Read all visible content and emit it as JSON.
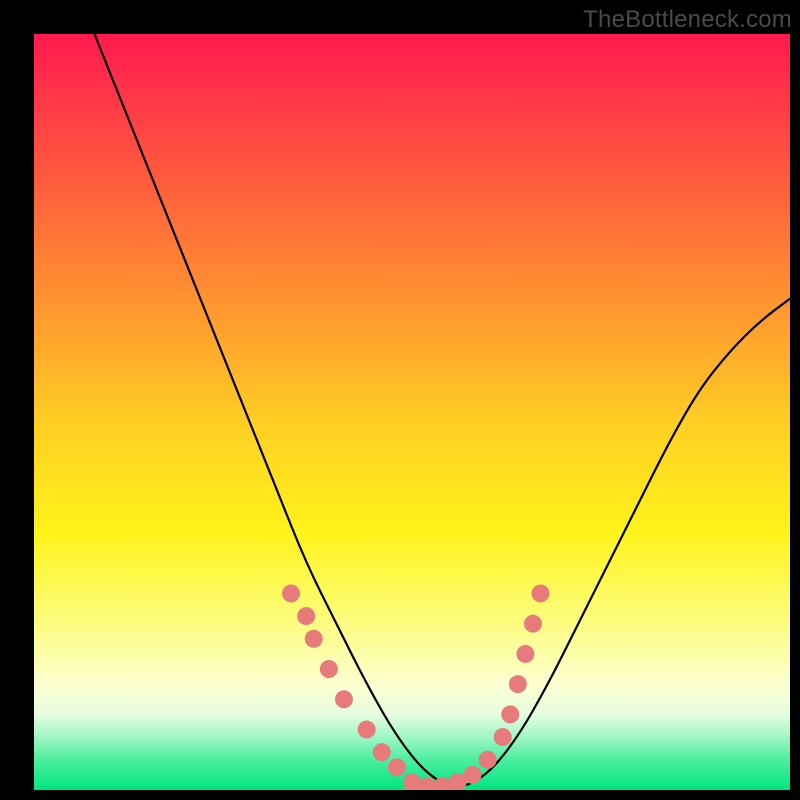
{
  "watermark": "TheBottleneck.com",
  "chart_data": {
    "type": "line",
    "title": "",
    "xlabel": "",
    "ylabel": "",
    "xlim": [
      0,
      100
    ],
    "ylim": [
      0,
      100
    ],
    "series": [
      {
        "name": "bottleneck-curve",
        "x": [
          8,
          12,
          16,
          20,
          24,
          28,
          32,
          36,
          40,
          44,
          48,
          52,
          56,
          60,
          64,
          68,
          72,
          76,
          80,
          84,
          88,
          92,
          96,
          100
        ],
        "y": [
          100,
          90,
          80,
          70,
          60,
          50,
          40,
          30,
          22,
          14,
          7,
          2,
          0,
          2,
          7,
          14,
          22,
          30,
          38,
          46,
          53,
          58,
          62,
          65
        ]
      }
    ],
    "scatter_points": {
      "name": "highlighted-points",
      "points": [
        {
          "x": 34,
          "y": 26
        },
        {
          "x": 36,
          "y": 23
        },
        {
          "x": 37,
          "y": 20
        },
        {
          "x": 39,
          "y": 16
        },
        {
          "x": 41,
          "y": 12
        },
        {
          "x": 44,
          "y": 8
        },
        {
          "x": 46,
          "y": 5
        },
        {
          "x": 48,
          "y": 3
        },
        {
          "x": 50,
          "y": 1
        },
        {
          "x": 52,
          "y": 0.5
        },
        {
          "x": 54,
          "y": 0.5
        },
        {
          "x": 56,
          "y": 1
        },
        {
          "x": 58,
          "y": 2
        },
        {
          "x": 60,
          "y": 4
        },
        {
          "x": 62,
          "y": 7
        },
        {
          "x": 63,
          "y": 10
        },
        {
          "x": 64,
          "y": 14
        },
        {
          "x": 65,
          "y": 18
        },
        {
          "x": 66,
          "y": 22
        },
        {
          "x": 67,
          "y": 26
        }
      ]
    },
    "colors": {
      "gradient_top": "#ff1a4d",
      "gradient_mid": "#fff31a",
      "gradient_bottom": "#00e57d",
      "curve": "#000000",
      "dots": "#e77b7b",
      "frame": "#000000"
    }
  }
}
